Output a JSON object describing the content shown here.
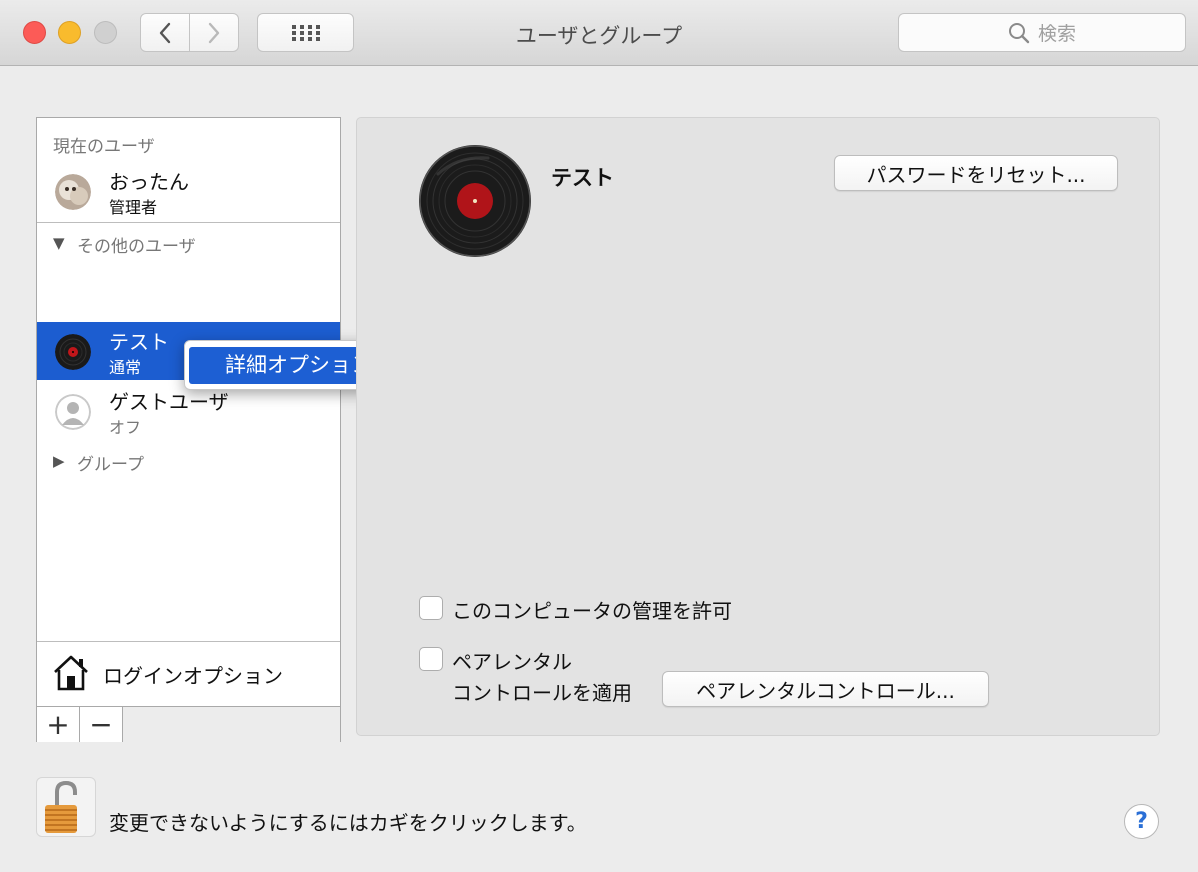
{
  "window": {
    "title": "ユーザとグループ",
    "search_placeholder": "検索"
  },
  "sidebar": {
    "current_users_header": "現在のユーザ",
    "current_user": {
      "name": "おったん",
      "role": "管理者"
    },
    "other_users_header": "その他のユーザ",
    "other_users": [
      {
        "name": "テスト",
        "role": "通常",
        "selected": true
      },
      {
        "name": "ゲストユーザ",
        "role": "オフ",
        "selected": false
      }
    ],
    "groups_header": "グループ",
    "login_options_label": "ログインオプション",
    "add_label": "+",
    "remove_label": "−"
  },
  "context_menu": {
    "item": "詳細オプション..."
  },
  "detail": {
    "user_name": "テスト",
    "reset_password_label": "パスワードをリセット...",
    "allow_admin_label": "このコンピュータの管理を許可",
    "parental_line1": "ペアレンタル",
    "parental_line2": "コントロールを適用",
    "parental_button_label": "ペアレンタルコントロール..."
  },
  "footer": {
    "lock_text": "変更できないようにするにはカギをクリックします。",
    "help_label": "?"
  },
  "colors": {
    "selection": "#1c5dd0",
    "close": "#fc5b57",
    "minimize": "#f9bb2d"
  }
}
